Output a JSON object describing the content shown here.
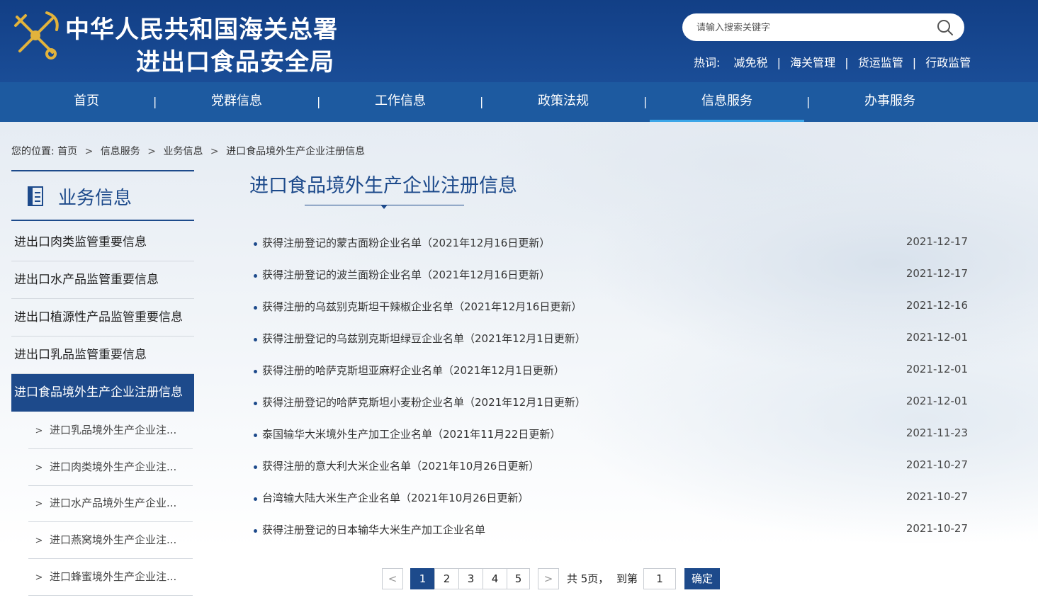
{
  "header": {
    "title_line1": "中华人民共和国海关总署",
    "title_line2": "进出口食品安全局",
    "search_placeholder": "请输入搜索关键字",
    "hot_label": "热词:",
    "hot_words": [
      "减免税",
      "海关管理",
      "货运监管",
      "行政监管"
    ],
    "hot_separator": "|"
  },
  "nav": {
    "items": [
      "首页",
      "党群信息",
      "工作信息",
      "政策法规",
      "信息服务",
      "办事服务"
    ],
    "separator": "|",
    "active": "信息服务"
  },
  "breadcrumb": {
    "prefix": "您的位置:",
    "items": [
      "首页",
      "信息服务",
      "业务信息",
      "进口食品境外生产企业注册信息"
    ],
    "separator": ">"
  },
  "sidebar": {
    "title": "业务信息",
    "items": [
      "进出口肉类监管重要信息",
      "进出口水产品监管重要信息",
      "进出口植源性产品监管重要信息",
      "进出口乳品监管重要信息",
      "进口食品境外生产企业注册信息"
    ],
    "active_index": 4,
    "sub_arrow": ">",
    "sub_items": [
      "进口乳品境外生产企业注...",
      "进口肉类境外生产企业注...",
      "进口水产品境外生产企业...",
      "进口燕窝境外生产企业注...",
      "进口蜂蜜境外生产企业注..."
    ]
  },
  "main": {
    "title": "进口食品境外生产企业注册信息",
    "news": [
      {
        "title": "获得注册登记的蒙古面粉企业名单（2021年12月16日更新）",
        "date": "2021-12-17"
      },
      {
        "title": "获得注册登记的波兰面粉企业名单（2021年12月16日更新）",
        "date": "2021-12-17"
      },
      {
        "title": "获得注册的乌兹别克斯坦干辣椒企业名单（2021年12月16日更新）",
        "date": "2021-12-16"
      },
      {
        "title": "获得注册登记的乌兹别克斯坦绿豆企业名单（2021年12月1日更新）",
        "date": "2021-12-01"
      },
      {
        "title": "获得注册的哈萨克斯坦亚麻籽企业名单（2021年12月1日更新）",
        "date": "2021-12-01"
      },
      {
        "title": "获得注册登记的哈萨克斯坦小麦粉企业名单（2021年12月1日更新）",
        "date": "2021-12-01"
      },
      {
        "title": "泰国输华大米境外生产加工企业名单（2021年11月22日更新）",
        "date": "2021-11-23"
      },
      {
        "title": "获得注册的意大利大米企业名单（2021年10月26日更新）",
        "date": "2021-10-27"
      },
      {
        "title": "台湾输大陆大米生产企业名单（2021年10月26日更新）",
        "date": "2021-10-27"
      },
      {
        "title": "获得注册登记的日本输华大米生产加工企业名单",
        "date": "2021-10-27"
      }
    ]
  },
  "pagination": {
    "prev": "<",
    "next": ">",
    "pages": [
      "1",
      "2",
      "3",
      "4",
      "5"
    ],
    "current": "1",
    "total_text": "共 5页，",
    "goto_label": "到第",
    "goto_value": "1",
    "confirm": "确定"
  },
  "colors": {
    "header_bg": "#123f86",
    "nav_bg": "#1d5aa0",
    "accent": "#1d4a8b",
    "active_underline": "#3ba6e8"
  }
}
